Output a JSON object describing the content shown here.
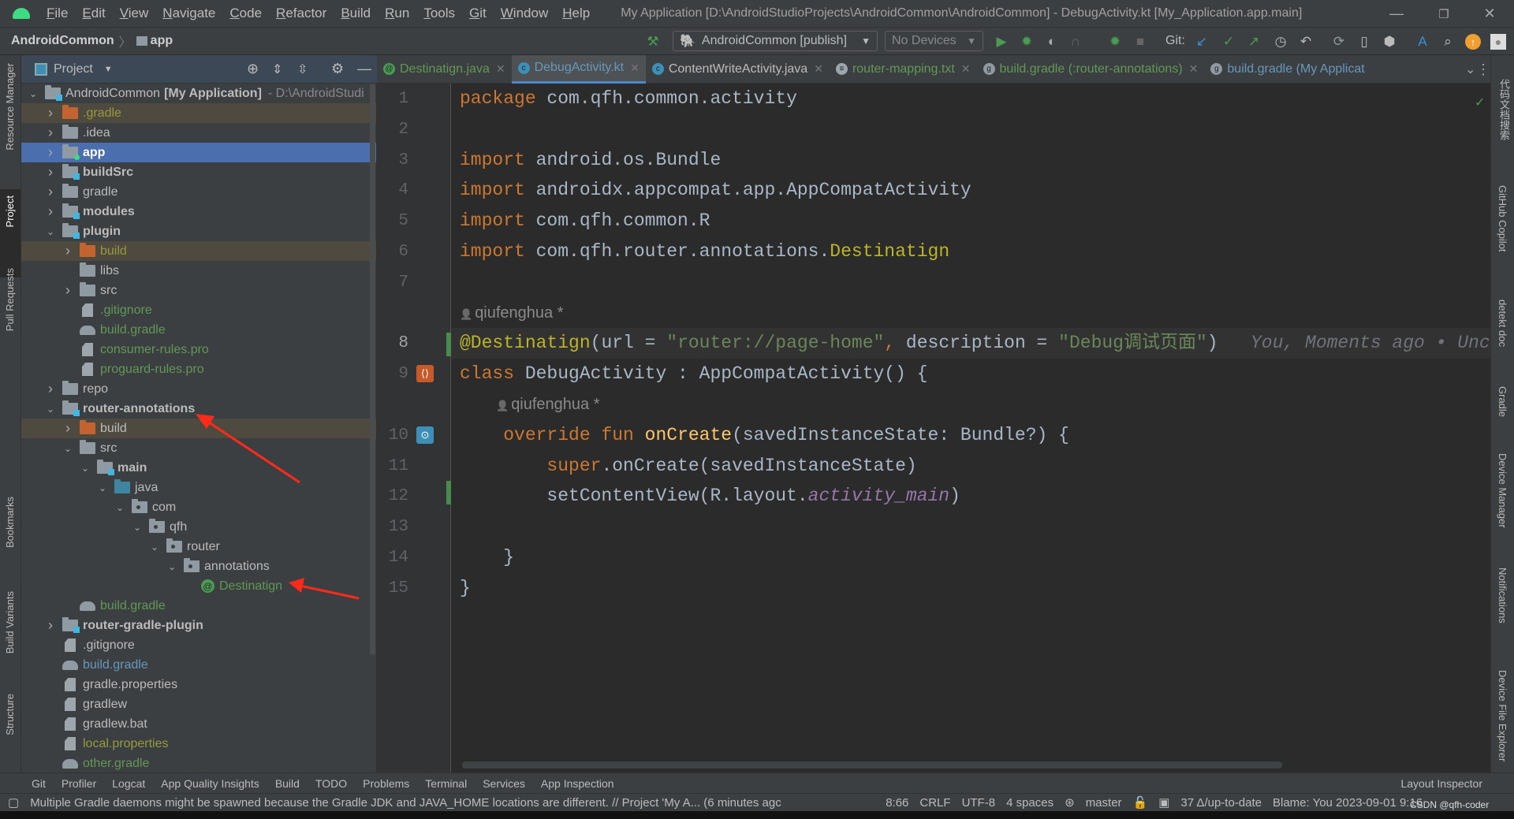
{
  "titlebar": {
    "menus": [
      "File",
      "Edit",
      "View",
      "Navigate",
      "Code",
      "Refactor",
      "Build",
      "Run",
      "Tools",
      "Git",
      "Window",
      "Help"
    ],
    "title": "My Application [D:\\AndroidStudioProjects\\AndroidCommon\\AndroidCommon] - DebugActivity.kt [My_Application.app.main]",
    "minimize": "—",
    "restore": "❐",
    "close": "✕"
  },
  "navbar": {
    "crumbs": [
      "AndroidCommon",
      "app"
    ],
    "run_config": "AndroidCommon [publish]",
    "device": "No Devices",
    "git_label": "Git:"
  },
  "left_strip": [
    "Resource Manager",
    "Project",
    "Pull Requests",
    "Bookmarks",
    "Build Variants",
    "Structure"
  ],
  "right_strip": [
    "代码文档搜索",
    "GitHub Copilot",
    "detekt doc",
    "Gradle",
    "Device Manager",
    "Notifications",
    "Device File Explorer"
  ],
  "project": {
    "title": "Project",
    "tree": [
      {
        "level": 0,
        "label": "AndroidCommon",
        "bold_suffix": "[My Application]",
        "path": " - D:\\AndroidStudi",
        "icon": "module",
        "expanded": true,
        "color": "#bbbbbb"
      },
      {
        "level": 1,
        "label": ".gradle",
        "icon": "folder-orange",
        "expanded": false,
        "color": "#99993d",
        "excluded": true
      },
      {
        "level": 1,
        "label": ".idea",
        "icon": "folder",
        "expanded": false,
        "color": "#bbbbbb"
      },
      {
        "level": 1,
        "label": "app",
        "icon": "app",
        "expanded": false,
        "color": "#ffffff",
        "bold": true,
        "selected": true
      },
      {
        "level": 1,
        "label": "buildSrc",
        "icon": "module",
        "expanded": false,
        "color": "#bbbbbb",
        "bold": true
      },
      {
        "level": 1,
        "label": "gradle",
        "icon": "folder",
        "expanded": false,
        "color": "#bbbbbb"
      },
      {
        "level": 1,
        "label": "modules",
        "icon": "module",
        "expanded": false,
        "color": "#bbbbbb",
        "bold": true
      },
      {
        "level": 1,
        "label": "plugin",
        "icon": "module",
        "expanded": true,
        "color": "#bbbbbb",
        "bold": true
      },
      {
        "level": 2,
        "label": "build",
        "icon": "folder-orange",
        "expanded": false,
        "color": "#99993d",
        "excluded": true
      },
      {
        "level": 2,
        "label": "libs",
        "icon": "folder",
        "color": "#bbbbbb"
      },
      {
        "level": 2,
        "label": "src",
        "icon": "folder",
        "expanded": false,
        "color": "#bbbbbb"
      },
      {
        "level": 2,
        "label": ".gitignore",
        "icon": "file",
        "color": "#629755"
      },
      {
        "level": 2,
        "label": "build.gradle",
        "icon": "gradle",
        "color": "#629755"
      },
      {
        "level": 2,
        "label": "consumer-rules.pro",
        "icon": "file",
        "color": "#629755"
      },
      {
        "level": 2,
        "label": "proguard-rules.pro",
        "icon": "file",
        "color": "#629755"
      },
      {
        "level": 1,
        "label": "repo",
        "icon": "folder",
        "expanded": false,
        "color": "#bbbbbb"
      },
      {
        "level": 1,
        "label": "router-annotations",
        "icon": "module",
        "expanded": true,
        "color": "#bbbbbb",
        "bold": true
      },
      {
        "level": 2,
        "label": "build",
        "icon": "folder-orange",
        "expanded": false,
        "color": "#bbbbbb",
        "excluded": true
      },
      {
        "level": 2,
        "label": "src",
        "icon": "folder",
        "expanded": true,
        "color": "#bbbbbb"
      },
      {
        "level": 3,
        "label": "main",
        "icon": "module",
        "expanded": true,
        "color": "#bbbbbb",
        "bold": true
      },
      {
        "level": 4,
        "label": "java",
        "icon": "folder-blue",
        "expanded": true,
        "color": "#bbbbbb"
      },
      {
        "level": 5,
        "label": "com",
        "icon": "package",
        "expanded": true,
        "color": "#bbbbbb"
      },
      {
        "level": 6,
        "label": "qfh",
        "icon": "package",
        "expanded": true,
        "color": "#bbbbbb"
      },
      {
        "level": 7,
        "label": "router",
        "icon": "package",
        "expanded": true,
        "color": "#bbbbbb"
      },
      {
        "level": 8,
        "label": "annotations",
        "icon": "package",
        "expanded": true,
        "color": "#bbbbbb"
      },
      {
        "level": 9,
        "label": "Destinatign",
        "icon": "annotation",
        "color": "#629755"
      },
      {
        "level": 2,
        "label": "build.gradle",
        "icon": "gradle",
        "color": "#629755"
      },
      {
        "level": 1,
        "label": "router-gradle-plugin",
        "icon": "module",
        "expanded": false,
        "color": "#bbbbbb",
        "bold": true
      },
      {
        "level": 1,
        "label": ".gitignore",
        "icon": "file",
        "color": "#bbbbbb"
      },
      {
        "level": 1,
        "label": "build.gradle",
        "icon": "gradle",
        "color": "#6897bb"
      },
      {
        "level": 1,
        "label": "gradle.properties",
        "icon": "file",
        "color": "#bbbbbb"
      },
      {
        "level": 1,
        "label": "gradlew",
        "icon": "file",
        "color": "#bbbbbb"
      },
      {
        "level": 1,
        "label": "gradlew.bat",
        "icon": "file",
        "color": "#bbbbbb"
      },
      {
        "level": 1,
        "label": "local.properties",
        "icon": "file",
        "color": "#99993d"
      },
      {
        "level": 1,
        "label": "other.gradle",
        "icon": "gradle",
        "color": "#629755"
      }
    ]
  },
  "tabs": [
    {
      "label": "Destinatign.java",
      "color": "#629755",
      "icon": "@",
      "icon_bg": "#499c54"
    },
    {
      "label": "DebugActivity.kt",
      "color": "#6897bb",
      "icon": "c",
      "icon_bg": "#3d8fb8",
      "active": true
    },
    {
      "label": "ContentWriteActivity.java",
      "color": "#bbbbbb",
      "icon": "c",
      "icon_bg": "#3d8fb8"
    },
    {
      "label": "router-mapping.txt",
      "color": "#629755",
      "icon": "≡",
      "icon_bg": "#9da6ad"
    },
    {
      "label": "build.gradle (:router-annotations)",
      "color": "#629755",
      "icon": "g",
      "icon_bg": "#8f9aa3"
    },
    {
      "label": "build.gradle (My Applicat",
      "color": "#6897bb",
      "icon": "g",
      "icon_bg": "#8f9aa3",
      "noclose": true
    }
  ],
  "editor": {
    "lines": [
      {
        "n": "1",
        "tokens": [
          [
            "kw",
            "package "
          ],
          [
            "",
            "com.qfh.common.activity"
          ]
        ]
      },
      {
        "n": "2",
        "tokens": []
      },
      {
        "n": "3",
        "tokens": [
          [
            "kw",
            "import "
          ],
          [
            "",
            "android.os.Bundle"
          ]
        ]
      },
      {
        "n": "4",
        "tokens": [
          [
            "kw",
            "import "
          ],
          [
            "",
            "androidx.appcompat.app.AppCompatActivity"
          ]
        ]
      },
      {
        "n": "5",
        "tokens": [
          [
            "kw",
            "import "
          ],
          [
            "",
            "com.qfh.common.R"
          ]
        ]
      },
      {
        "n": "6",
        "tokens": [
          [
            "kw",
            "import "
          ],
          [
            "",
            "com.qfh.router.annotations."
          ],
          [
            "ann",
            "Destinatign"
          ]
        ]
      },
      {
        "n": "7",
        "tokens": []
      },
      {
        "author": "qiufenghua *",
        "indent": 0
      },
      {
        "n": "8",
        "current": true,
        "tokens": [
          [
            "ann",
            "@Destinatign"
          ],
          [
            "",
            "(url = "
          ],
          [
            "str",
            "\"router://page-home\""
          ],
          [
            "kw",
            ", "
          ],
          [
            "",
            "description = "
          ],
          [
            "str",
            "\"Debug调试页面\""
          ],
          [
            "",
            ")"
          ],
          [
            "hint",
            "   You, Moments ago • Uncommitted changes"
          ]
        ]
      },
      {
        "n": "9",
        "tokens": [
          [
            "kw",
            "class "
          ],
          [
            "",
            "DebugActivity : AppCompatActivity() {"
          ]
        ]
      },
      {
        "author": "qiufenghua *",
        "indent": 1
      },
      {
        "n": "10",
        "tokens": [
          [
            "",
            "    "
          ],
          [
            "kw",
            "override fun "
          ],
          [
            "fn",
            "onCreate"
          ],
          [
            "",
            "(savedInstanceState: Bundle?) {"
          ]
        ]
      },
      {
        "n": "11",
        "tokens": [
          [
            "",
            "        "
          ],
          [
            "kw",
            "super"
          ],
          [
            "",
            ".onCreate(savedInstanceState)"
          ]
        ]
      },
      {
        "n": "12",
        "tokens": [
          [
            "",
            "        setContentView(R.layout."
          ],
          [
            "it",
            "activity_main"
          ],
          [
            "",
            ")"
          ]
        ]
      },
      {
        "n": "13",
        "tokens": []
      },
      {
        "n": "14",
        "tokens": [
          [
            "",
            "    }"
          ]
        ]
      },
      {
        "n": "15",
        "tokens": [
          [
            "",
            "}"
          ]
        ]
      }
    ]
  },
  "bottom_tools": [
    "Git",
    "Profiler",
    "Logcat",
    "App Quality Insights",
    "Build",
    "TODO",
    "Problems",
    "Terminal",
    "Services",
    "App Inspection"
  ],
  "layout_inspector": "Layout Inspector",
  "status": {
    "message": "Multiple Gradle daemons might be spawned because the Gradle JDK and JAVA_HOME locations are different. // Project 'My A... (6 minutes agc",
    "position": "8:66",
    "line_sep": "CRLF",
    "encoding": "UTF-8",
    "indent": "4 spaces",
    "branch": "master",
    "updates": "37 Δ/up-to-date",
    "blame": "Blame: You 2023-09-01 9:16",
    "watermark": "CSDN @qfh-coder"
  },
  "colors": {
    "accent": "#4b6eaf",
    "annotation_arrow": "#ff2a1a",
    "keyword": "#cc7832",
    "string": "#6a8759"
  }
}
